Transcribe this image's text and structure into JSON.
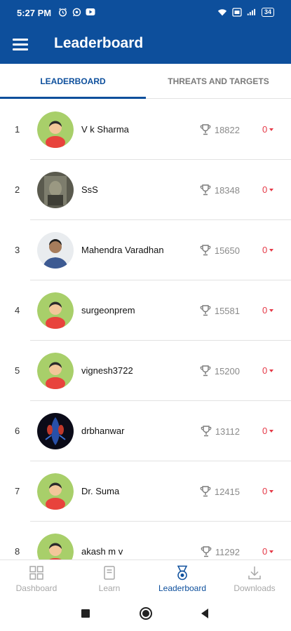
{
  "status": {
    "time": "5:27 PM",
    "battery": "34",
    "left_icons": [
      "alarm-icon",
      "whatsapp-icon",
      "youtube-icon"
    ],
    "right_icons": [
      "wifi-icon",
      "volte-icon",
      "signal-icon",
      "battery-icon"
    ]
  },
  "appbar": {
    "title": "Leaderboard"
  },
  "tabs": [
    {
      "label": "LEADERBOARD",
      "active": true
    },
    {
      "label": "THREATS AND TARGETS",
      "active": false
    }
  ],
  "leaders": [
    {
      "rank": "1",
      "name": "V k Sharma",
      "score": "18822",
      "delta": "0",
      "avatar": "default"
    },
    {
      "rank": "2",
      "name": "SsS",
      "score": "18348",
      "delta": "0",
      "avatar": "photo-dark"
    },
    {
      "rank": "3",
      "name": "Mahendra Varadhan",
      "score": "15650",
      "delta": "0",
      "avatar": "photo-person"
    },
    {
      "rank": "4",
      "name": "surgeonprem",
      "score": "15581",
      "delta": "0",
      "avatar": "default"
    },
    {
      "rank": "5",
      "name": "vignesh3722",
      "score": "15200",
      "delta": "0",
      "avatar": "default"
    },
    {
      "rank": "6",
      "name": "drbhanwar",
      "score": "13112",
      "delta": "0",
      "avatar": "photo-anatomy"
    },
    {
      "rank": "7",
      "name": "Dr. Suma",
      "score": "12415",
      "delta": "0",
      "avatar": "default"
    },
    {
      "rank": "8",
      "name": "akash m v",
      "score": "11292",
      "delta": "0",
      "avatar": "default"
    }
  ],
  "bottom_nav": [
    {
      "label": "Dashboard",
      "icon": "dashboard-icon",
      "active": false
    },
    {
      "label": "Learn",
      "icon": "book-icon",
      "active": false
    },
    {
      "label": "Leaderboard",
      "icon": "medal-icon",
      "active": true
    },
    {
      "label": "Downloads",
      "icon": "download-icon",
      "active": false
    }
  ],
  "colors": {
    "primary": "#0d4f9c",
    "delta": "#e53947",
    "avatar_bg": "#a8cf6a",
    "avatar_face": "#f2c79a",
    "avatar_body": "#e8433c",
    "inactive": "#a8a8a8"
  }
}
